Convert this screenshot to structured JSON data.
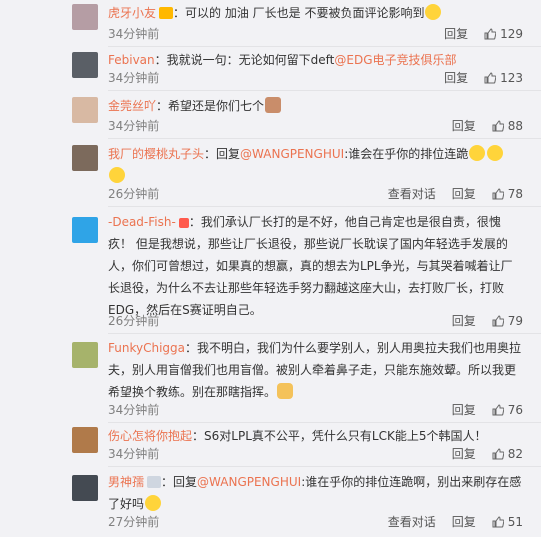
{
  "comments": [
    {
      "name": "虎牙小友",
      "sep": "：",
      "content": "可以的 加油 厂长也是 不要被负面评论影响到",
      "time": "34分钟前",
      "reply": "回复",
      "likes": "129",
      "reply_chain": ""
    },
    {
      "name": "Febivan",
      "sep": "：",
      "content": "我就说一句：无论如何留下deft",
      "mention": "@EDG电子竞技俱乐部",
      "time": "34分钟前",
      "reply": "回复",
      "likes": "123"
    },
    {
      "name": "金莞丝吖",
      "sep": "：",
      "content": "希望还是你们七个",
      "time": "34分钟前",
      "reply": "回复",
      "likes": "88"
    },
    {
      "name": "我厂的樱桃丸子头",
      "sep": "：",
      "prefix": "回复",
      "mention": "@WANGPENGHUI",
      "content": ":谁会在乎你的排位连跪",
      "time": "26分钟前",
      "view_convo": "查看对话",
      "reply": "回复",
      "likes": "78"
    },
    {
      "name": "-Dead-Fish-",
      "sep": "：",
      "content": "我们承认厂长打的是不好，他自己肯定也是很自责，很愧疚！ 但是我想说，那些让厂长退役，那些说厂长耽误了国内年轻选手发展的人，你们可曾想过，如果真的想赢，真的想去为LPL争光，与其哭着喊着让厂长退役，为什么不去让那些年轻选手努力翻越这座大山，去打败厂长，打败EDG，然后在S赛证明自己。",
      "time": "26分钟前",
      "reply": "回复",
      "likes": "79"
    },
    {
      "name": "FunkyChigga",
      "sep": "：",
      "content": "我不明白，我们为什么要学别人，别人用奥拉夫我们也用奥拉夫，别人用盲僧我们也用盲僧。被别人牵着鼻子走，只能东施效颦。所以我更希望换个教练。别在那瞎指挥。",
      "time": "34分钟前",
      "reply": "回复",
      "likes": "76"
    },
    {
      "name": "伤心怎将你抱起",
      "sep": "：",
      "content": "S6对LPL真不公平，凭什么只有LCK能上5个韩国人！",
      "time": "34分钟前",
      "reply": "回复",
      "likes": "82"
    },
    {
      "name": "男神孺",
      "sep": "：",
      "prefix": "回复",
      "mention": "@WANGPENGHUI",
      "content": ":谁在乎你的排位连跪啊，别出来刷存在感了好吗",
      "time": "27分钟前",
      "view_convo": "查看对话",
      "reply": "回复",
      "likes": "51"
    }
  ],
  "colors": {
    "name": "#eb7350",
    "text": "#333333",
    "meta": "#808080",
    "bg": "#f2f2f5"
  },
  "icons": {
    "like": "thumbs-up-icon"
  }
}
